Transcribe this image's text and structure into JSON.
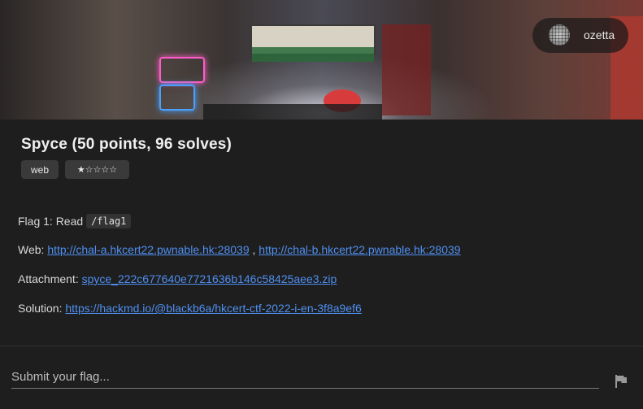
{
  "user": {
    "name": "ozetta"
  },
  "challenge": {
    "title": "Spyce (50 points, 96 solves)",
    "tags": [
      "web",
      "★☆☆☆☆"
    ]
  },
  "description": {
    "flag_label": "Flag 1: Read",
    "flag_path": "/flag1",
    "web_label": "Web:",
    "web_link_a": "http://chal-a.hkcert22.pwnable.hk:28039",
    "web_separator": ",",
    "web_link_b": "http://chal-b.hkcert22.pwnable.hk:28039",
    "attachment_label": "Attachment:",
    "attachment_link": "spyce_222c677640e7721636b146c58425aee3.zip",
    "solution_label": "Solution:",
    "solution_link": "https://hackmd.io/@blackb6a/hkcert-ctf-2022-i-en-3f8a9ef6"
  },
  "submit": {
    "placeholder": "Submit your flag...",
    "button_icon": "flag-icon"
  },
  "colors": {
    "background": "#1e1e1e",
    "link": "#4f8ff0",
    "tag_bg": "#3a3a3a"
  }
}
